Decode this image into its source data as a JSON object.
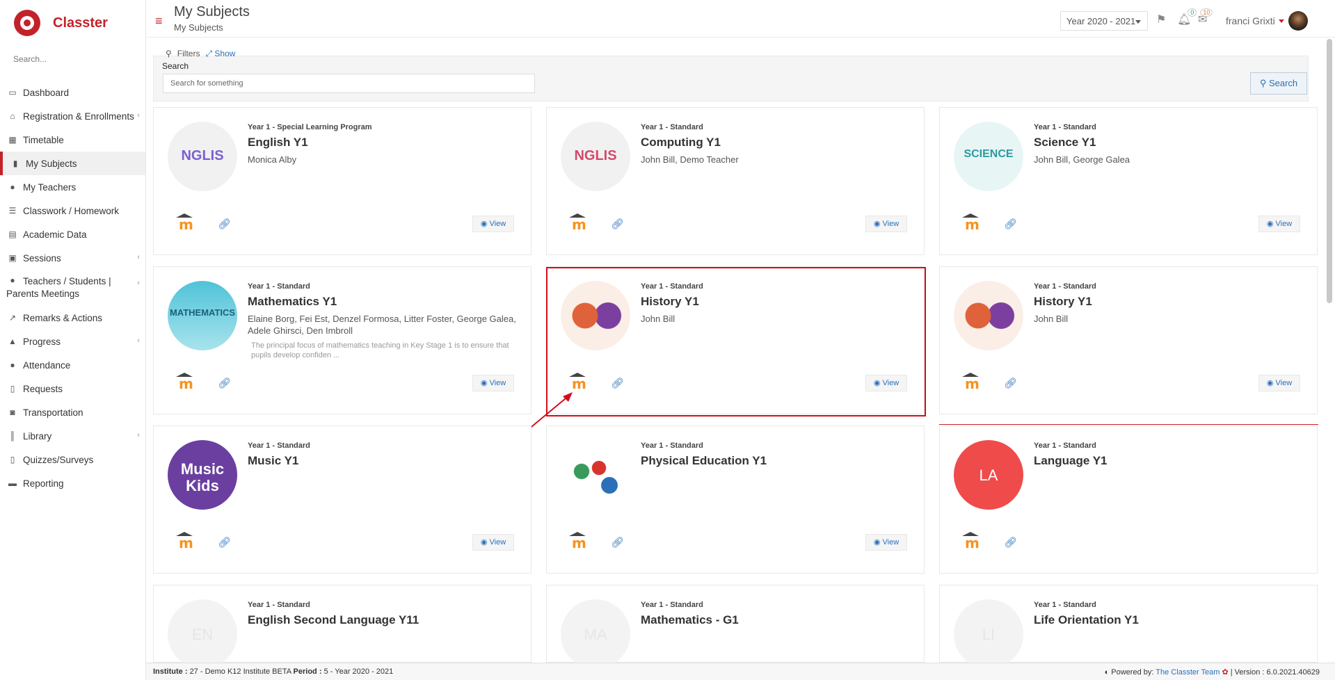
{
  "sidebar": {
    "logo_text": "Classter",
    "search_placeholder": "Search...",
    "items": [
      {
        "label": "Dashboard",
        "icon": "laptop-icon"
      },
      {
        "label": "Registration & Enrollments",
        "icon": "building-icon"
      },
      {
        "label": "Timetable",
        "icon": "calendar-icon"
      },
      {
        "label": "My Subjects",
        "icon": "book-icon"
      },
      {
        "label": "My Teachers",
        "icon": "users-icon"
      },
      {
        "label": "Classwork / Homework",
        "icon": "list-icon"
      },
      {
        "label": "Academic Data",
        "icon": "id-card-icon"
      },
      {
        "label": "Sessions",
        "icon": "sessions-icon"
      },
      {
        "label": "Teachers / Students |",
        "label2": "Parents Meetings",
        "icon": "user-gear-icon"
      },
      {
        "label": "Remarks & Actions",
        "icon": "remarks-icon"
      },
      {
        "label": "Progress",
        "icon": "graduation-icon"
      },
      {
        "label": "Attendance",
        "icon": "user-check-icon"
      },
      {
        "label": "Requests",
        "icon": "file-icon"
      },
      {
        "label": "Transportation",
        "icon": "bus-icon"
      },
      {
        "label": "Library",
        "icon": "library-icon"
      },
      {
        "label": "Quizzes/Surveys",
        "icon": "quiz-icon"
      },
      {
        "label": "Reporting",
        "icon": "print-icon"
      }
    ]
  },
  "header": {
    "title": "My Subjects",
    "breadcrumb": "My Subjects",
    "year": "Year 2020 - 2021",
    "notifications": "0",
    "messages": "10",
    "user": "franci Grixti"
  },
  "filters": {
    "filters_label": "Filters",
    "show_label": "Show",
    "search_label": "Search",
    "search_placeholder": "Search for something",
    "search_button": "Search"
  },
  "cards": [
    {
      "meta": "Year 1 - Special Learning Program",
      "name": "English Y1",
      "teachers": "Monica Alby",
      "thumb_text": "NGLIS",
      "view": "View"
    },
    {
      "meta": "Year 1 - Standard",
      "name": "Computing Y1",
      "teachers": "John Bill, Demo Teacher",
      "thumb_text": "NGLIS",
      "view": "View"
    },
    {
      "meta": "Year 1 - Standard",
      "name": "Science Y1",
      "teachers": "John Bill, George Galea",
      "thumb_text": "SCIENCE",
      "view": "View"
    },
    {
      "meta": "Year 1 - Standard",
      "name": "Mathematics Y1",
      "teachers": "Elaine Borg, Fei Est, Denzel Formosa, Litter Foster, George Galea, Adele Ghirsci, Den Imbroll",
      "desc": "The principal focus of mathematics teaching in Key Stage 1 is to ensure that pupils develop confiden ...",
      "thumb_text": "MATHEMATICS",
      "view": "View"
    },
    {
      "meta": "Year 1 - Standard",
      "name": "History Y1",
      "teachers": "John Bill",
      "thumb_text": "",
      "view": "View"
    },
    {
      "meta": "Year 1 - Standard",
      "name": "History Y1",
      "teachers": "John Bill",
      "thumb_text": "",
      "view": "View"
    },
    {
      "meta": "Year 1 - Standard",
      "name": "Music Y1",
      "teachers": "",
      "thumb_text": "Music Kids",
      "view": "View"
    },
    {
      "meta": "Year 1 - Standard",
      "name": "Physical Education Y1",
      "teachers": "",
      "thumb_text": "",
      "view": "View"
    },
    {
      "meta": "Year 1 - Standard",
      "name": "Language Y1",
      "teachers": "",
      "thumb_text": "LA",
      "view": ""
    },
    {
      "meta": "Year 1 - Standard",
      "name": "English Second Language Y11",
      "teachers": "",
      "thumb_text": "EN",
      "view": ""
    },
    {
      "meta": "Year 1 - Standard",
      "name": "Mathematics - G1",
      "teachers": "",
      "thumb_text": "MA",
      "view": ""
    },
    {
      "meta": "Year 1 - Standard",
      "name": "Life Orientation Y1",
      "teachers": "",
      "thumb_text": "LI",
      "view": ""
    }
  ],
  "footer": {
    "institute_label": "Institute :",
    "institute_value": "27 - Demo K12 Institute BETA",
    "period_label": "Period :",
    "period_value": "5 - Year 2020 - 2021",
    "powered": "Powered by:",
    "team": "The Classter Team",
    "version": "| Version : 6.0.2021.40629"
  },
  "colors": {
    "brand": "#c3222b",
    "link": "#2a6fb8",
    "highlight": "#d10d1c"
  }
}
